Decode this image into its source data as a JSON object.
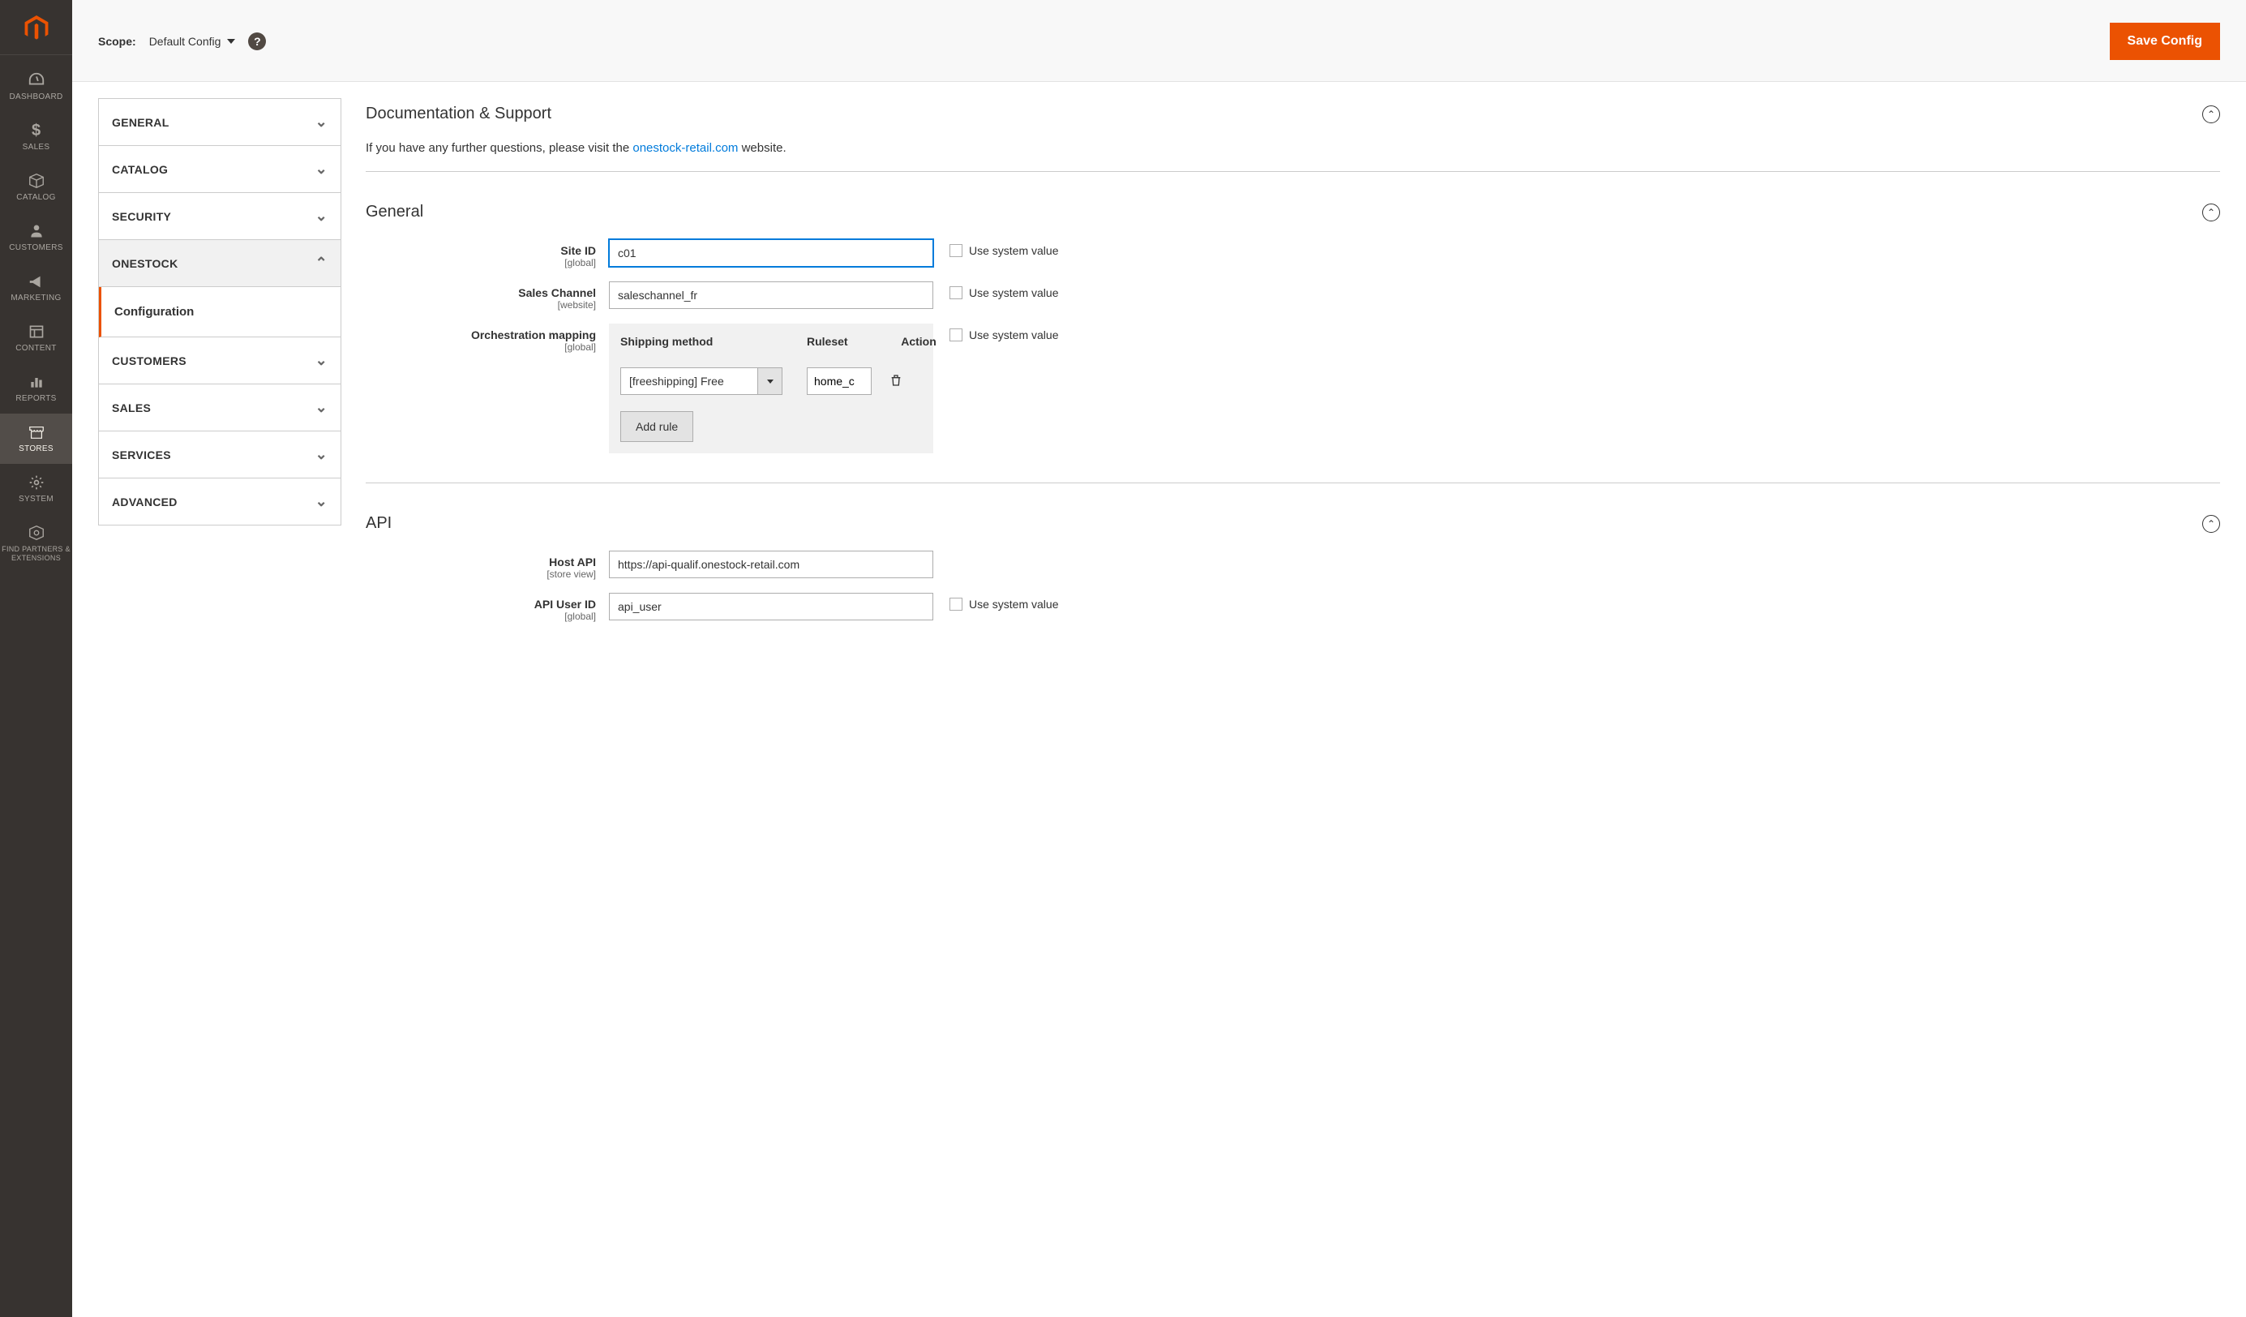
{
  "nav": {
    "items": [
      {
        "label": "DASHBOARD"
      },
      {
        "label": "SALES"
      },
      {
        "label": "CATALOG"
      },
      {
        "label": "CUSTOMERS"
      },
      {
        "label": "MARKETING"
      },
      {
        "label": "CONTENT"
      },
      {
        "label": "REPORTS"
      },
      {
        "label": "STORES"
      },
      {
        "label": "SYSTEM"
      },
      {
        "label": "FIND PARTNERS & EXTENSIONS"
      }
    ]
  },
  "header": {
    "scope_label": "Scope:",
    "scope_value": "Default Config",
    "save_button": "Save Config"
  },
  "tabs": {
    "general": "GENERAL",
    "catalog": "CATALOG",
    "security": "SECURITY",
    "onestock": "ONESTOCK",
    "onestock_sub": "Configuration",
    "customers": "CUSTOMERS",
    "sales": "SALES",
    "services": "SERVICES",
    "advanced": "ADVANCED"
  },
  "sections": {
    "doc_support": {
      "title": "Documentation & Support",
      "text_pre": "If you have any further questions, please visit the ",
      "link": "onestock-retail.com",
      "text_post": " website."
    },
    "general": {
      "title": "General",
      "site_id": {
        "label": "Site ID",
        "scope": "[global]",
        "value": "c01"
      },
      "sales_channel": {
        "label": "Sales Channel",
        "scope": "[website]",
        "value": "saleschannel_fr"
      },
      "orch": {
        "label": "Orchestration mapping",
        "scope": "[global]",
        "headers": {
          "method": "Shipping method",
          "ruleset": "Ruleset",
          "action": "Action"
        },
        "row": {
          "method": "[freeshipping] Free",
          "ruleset": "home_c"
        },
        "add_rule": "Add rule"
      }
    },
    "api": {
      "title": "API",
      "host": {
        "label": "Host API",
        "scope": "[store view]",
        "value": "https://api-qualif.onestock-retail.com"
      },
      "user": {
        "label": "API User ID",
        "scope": "[global]",
        "value": "api_user"
      }
    }
  },
  "common": {
    "use_system_value": "Use system value"
  }
}
